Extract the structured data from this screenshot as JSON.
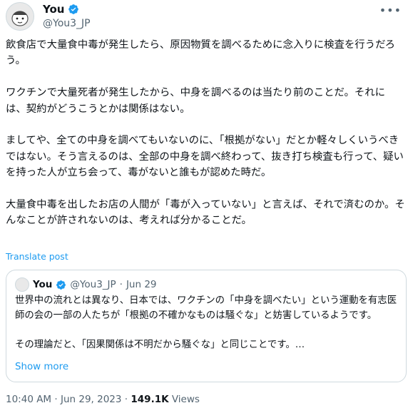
{
  "author": {
    "name": "You",
    "handle": "@You3_JP",
    "verified_color": "#1d9bf0"
  },
  "more_icon": "more-horizontal-icon",
  "tweet": {
    "paragraphs": [
      "飲食店で大量食中毒が発生したら、原因物質を調べるために念入りに検査を行うだろう。",
      "ワクチンで大量死者が発生したから、中身を調べるのは当たり前のことだ。それには、契約がどうこうとかは関係はない。",
      "ましてや、全ての中身を調べてもいないのに、「根拠がない」だとか軽々しくいうべきではない。そう言えるのは、全部の中身を調べ終わって、抜き打ち検査も行って、疑いを持った人が立ち会って、毒がないと誰もが認めた時だ。",
      "大量食中毒を出したお店の人間が「毒が入っていない」と言えば、それで済むのか。そんなことが許されないのは、考えれば分かることだ。"
    ],
    "translate": "Translate post"
  },
  "quote": {
    "name": "You",
    "handle": "@You3_JP",
    "separator": "·",
    "date": "Jun 29",
    "paragraphs": [
      "世界中の流れとは異なり、日本では、ワクチンの「中身を調べたい」という運動を有志医師の会の一部の人たちが「根拠の不確かなものは騒ぐな」と妨害しているようです。",
      "その理論だと、「因果関係は不明だから騒ぐな」と同じことです。…"
    ],
    "show_more": "Show more"
  },
  "meta": {
    "time": "10:40 AM",
    "separator": "·",
    "date": "Jun 29, 2023",
    "separator2": "·",
    "views_count": "149.1K",
    "views_label": "Views"
  },
  "colors": {
    "accent": "#1d9bf0",
    "text": "#0f1419",
    "muted": "#536471",
    "border": "#cfd9de"
  }
}
